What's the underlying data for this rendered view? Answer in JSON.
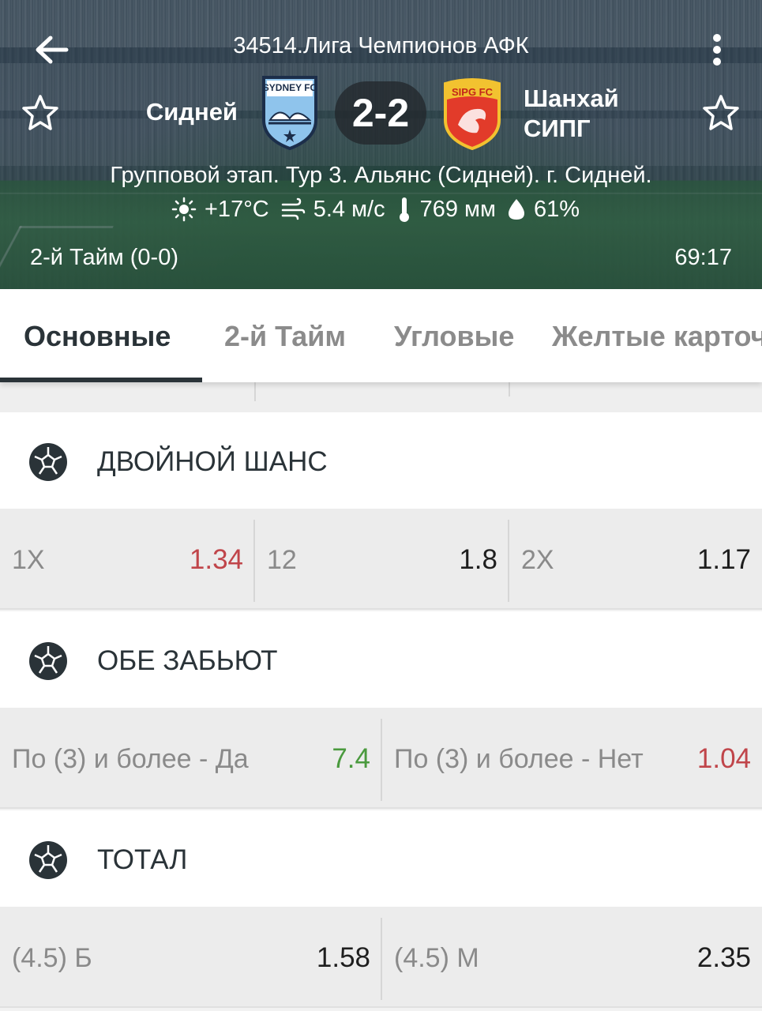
{
  "header": {
    "league_title": "34514.Лига Чемпионов АФК",
    "home_team": "Сидней",
    "away_team": "Шанхай СИПГ",
    "score": "2-2",
    "stage_text": "Групповой этап. Тур 3. Альянс (Сидней). г. Сидней.",
    "period_text": "2-й  Тайм (0-0)",
    "match_clock": "69:17",
    "home_logo_text": "SYDNEY FC",
    "away_logo_text": "SIPG FC",
    "weather": {
      "temperature": "+17°C",
      "wind": "5.4 м/с",
      "pressure": "769 мм",
      "humidity": "61%"
    }
  },
  "tabs": [
    {
      "label": "Основные",
      "active": true
    },
    {
      "label": "2-й  Тайм",
      "active": false
    },
    {
      "label": "Угловые",
      "active": false
    },
    {
      "label": "Желтые карточки",
      "active": false
    }
  ],
  "markets": [
    {
      "title": "ДВОЙНОЙ ШАНС",
      "outcomes": [
        {
          "label": "1X",
          "odds": "1.34",
          "trend": "down"
        },
        {
          "label": "12",
          "odds": "1.8",
          "trend": "none"
        },
        {
          "label": "2X",
          "odds": "1.17",
          "trend": "none"
        }
      ]
    },
    {
      "title": "ОБЕ ЗАБЬЮТ",
      "outcomes": [
        {
          "label": "По (3) и более - Да",
          "odds": "7.4",
          "trend": "up"
        },
        {
          "label": "По (3) и более - Нет",
          "odds": "1.04",
          "trend": "down"
        }
      ]
    },
    {
      "title": "ТОТАЛ",
      "outcomes": [
        {
          "label": "(4.5) Б",
          "odds": "1.58",
          "trend": "none"
        },
        {
          "label": "(4.5) М",
          "odds": "2.35",
          "trend": "none"
        }
      ]
    }
  ],
  "colors": {
    "odds_down": "#c0454a",
    "odds_up": "#4a9a3e",
    "odds_default": "#1e1e1e",
    "tab_active": "#2a3338",
    "tab_inactive": "#8b8b8b"
  },
  "icons": {
    "back": "arrow-left-icon",
    "menu": "more-vertical-icon",
    "favorite": "star-outline-icon",
    "market": "soccer-ball-icon",
    "temperature": "sun-icon",
    "wind": "wind-icon",
    "pressure": "thermometer-icon",
    "humidity": "water-drop-icon"
  }
}
